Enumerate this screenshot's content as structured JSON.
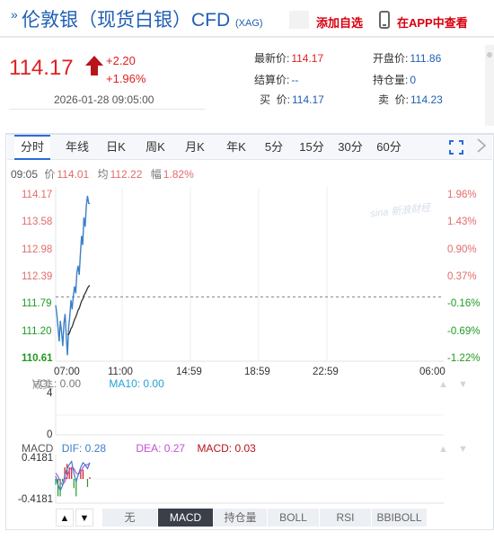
{
  "header": {
    "title": "伦敦银（现货白银）CFD",
    "code": "(XAG)",
    "watch_label": "添加自选",
    "app_label": "在APP中查看"
  },
  "quote": {
    "price": "114.17",
    "change": "+2.20",
    "change_pct": "+1.96%",
    "datetime": "2026-01-28 09:05:00"
  },
  "stats": {
    "latest_label": "最新价:",
    "latest": "114.17",
    "open_label": "开盘价:",
    "open": "111.86",
    "settle_label": "结算价:",
    "settle": "--",
    "oi_label": "持仓量:",
    "oi": "0",
    "bid_label": "买  价:",
    "bid": "114.17",
    "ask_label": "卖  价:",
    "ask": "114.23"
  },
  "tabs": [
    "分时",
    "年线",
    "日K",
    "周K",
    "月K",
    "年K",
    "5分",
    "15分",
    "30分",
    "60分"
  ],
  "active_tab": "分时",
  "info_line": {
    "time": "09:05",
    "price_label": "价",
    "price": "114.01",
    "avg_label": "均",
    "avg": "112.22",
    "amp_label": "幅",
    "amp": "1.82%"
  },
  "watermark": "sina 新浪财经",
  "chart_data": {
    "type": "line",
    "title": "",
    "y_price_ticks": [
      "114.17",
      "113.58",
      "112.98",
      "112.39",
      "111.79",
      "111.20",
      "110.61"
    ],
    "y_pct_ticks": [
      "1.96%",
      "1.43%",
      "0.90%",
      "0.37%",
      "-0.16%",
      "-0.69%",
      "-1.22%"
    ],
    "x_ticks": [
      "07:00",
      "11:00",
      "14:59",
      "18:59",
      "22:59",
      "06:00"
    ],
    "prev_close": 111.97,
    "ylim": [
      110.61,
      114.17
    ],
    "series": [
      {
        "values": [
          111.79,
          111.6,
          111.3,
          111.0,
          111.45,
          111.2,
          110.9,
          111.4,
          111.6,
          111.1,
          110.7,
          111.3,
          111.55,
          111.9,
          111.7,
          112.0,
          112.2,
          112.05,
          112.5,
          112.65,
          112.45,
          112.9,
          113.3,
          113.1,
          113.7,
          113.5,
          113.95,
          114.17,
          114.01,
          114.0
        ],
        "color": "#3c7fc8"
      },
      {
        "values": [
          111.5,
          111.45,
          111.38,
          111.3,
          111.3,
          111.28,
          111.22,
          111.22,
          111.25,
          111.22,
          111.15,
          111.15,
          111.2,
          111.28,
          111.32,
          111.4,
          111.48,
          111.53,
          111.6,
          111.68,
          111.72,
          111.8,
          111.88,
          111.92,
          112.0,
          112.05,
          112.1,
          112.16,
          112.2,
          112.22
        ],
        "color": "#333333"
      }
    ]
  },
  "volume": {
    "title": "成交",
    "vol_label": "VOL: 0.00",
    "ma_label": "MA10: 0.00",
    "ticks": [
      "4",
      "0"
    ]
  },
  "macd": {
    "title": "MACD",
    "dif_label": "DIF: 0.28",
    "dea_label": "DEA: 0.27",
    "macd_label": "MACD: 0.03",
    "ticks": [
      "0.4181",
      "-0.4181"
    ],
    "dif": [
      0.05,
      -0.1,
      -0.2,
      -0.12,
      0.05,
      0.18,
      0.25,
      0.3,
      0.1,
      -0.05,
      0.08,
      0.2,
      0.28,
      0.24,
      0.18,
      0.28
    ],
    "dea": [
      0.1,
      0.05,
      -0.05,
      -0.1,
      -0.05,
      0.05,
      0.15,
      0.2,
      0.18,
      0.1,
      0.08,
      0.12,
      0.2,
      0.24,
      0.25,
      0.27
    ],
    "bars": [
      -0.1,
      -0.3,
      -0.3,
      -0.05,
      0.2,
      0.26,
      0.2,
      0.2,
      -0.16,
      -0.3,
      0.0,
      0.16,
      0.16,
      0.0,
      -0.14,
      0.03
    ]
  },
  "indicators": [
    "无",
    "MACD",
    "持仓量",
    "BOLL",
    "RSI",
    "BBIBOLL"
  ],
  "active_indicator": "MACD",
  "colors": {
    "up": "#e02020",
    "down": "#229922",
    "brand": "#1f5fb3",
    "accent": "#2a6ad8"
  }
}
